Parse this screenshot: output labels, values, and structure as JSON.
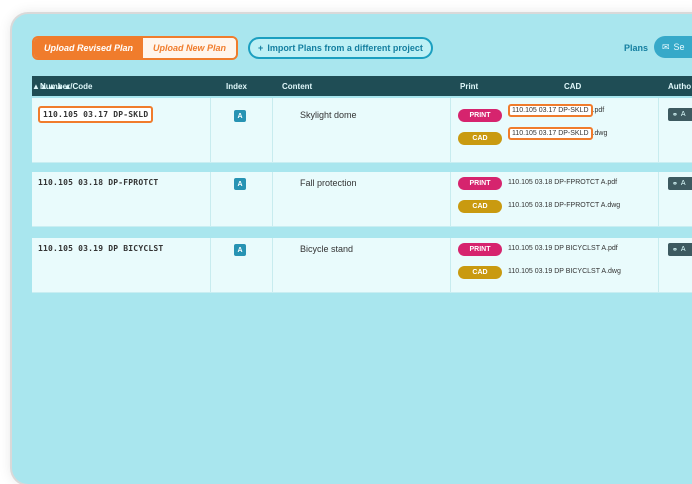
{
  "toolbar": {
    "upload_revised": "Upload Revised Plan",
    "upload_new": "Upload New Plan",
    "import_icon": "+",
    "import_label": "Import Plans from a different project",
    "plans_label": "Plans",
    "plans_button": "Se"
  },
  "table": {
    "headers": {
      "number": "Number/Code",
      "index": "Index",
      "content": "Content",
      "print": "Print",
      "cad": "CAD",
      "author": "Autho"
    },
    "rows": [
      {
        "code": "110.105 03.17 DP-SKLD",
        "index": "A",
        "content": "Skylight dome",
        "print_badge": "PRINT",
        "print_file_hl": "110.105 03.17 DP-SKLD",
        "print_file_suffix": ".pdf",
        "cad_badge": "CAD",
        "cad_file_hl": "110.105 03.17 DP-SKLD",
        "cad_file_suffix": ".dwg",
        "author": "A"
      },
      {
        "code": "110.105 03.18 DP-FPROTCT",
        "index": "A",
        "content": "Fall protection",
        "print_badge": "PRINT",
        "print_file": "110.105 03.18 DP-FPROTCT A.pdf",
        "cad_badge": "CAD",
        "cad_file": "110.105 03.18 DP-FPROTCT A.dwg",
        "author": "A"
      },
      {
        "code": "110.105 03.19 DP BICYCLST",
        "index": "A",
        "content": "Bicycle stand",
        "print_badge": "PRINT",
        "print_file": "110.105 03.19 DP BICYCLST A.pdf",
        "cad_badge": "CAD",
        "cad_file": "110.105 03.19 DP BICYCLST A.dwg",
        "author": "A"
      }
    ]
  }
}
